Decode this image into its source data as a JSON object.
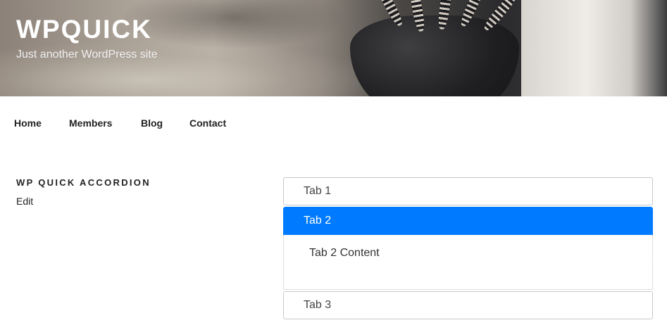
{
  "site": {
    "title": "WPQUICK",
    "description": "Just another WordPress site"
  },
  "nav": {
    "items": [
      {
        "label": "Home"
      },
      {
        "label": "Members"
      },
      {
        "label": "Blog"
      },
      {
        "label": "Contact"
      }
    ]
  },
  "widget": {
    "title": "WP QUICK ACCORDION",
    "edit_label": "Edit"
  },
  "accordion": {
    "tabs": [
      {
        "label": "Tab 1",
        "active": false
      },
      {
        "label": "Tab 2",
        "active": true,
        "content": "Tab 2 Content"
      },
      {
        "label": "Tab 3",
        "active": false
      }
    ]
  },
  "colors": {
    "accent": "#007bff",
    "text": "#222222"
  }
}
